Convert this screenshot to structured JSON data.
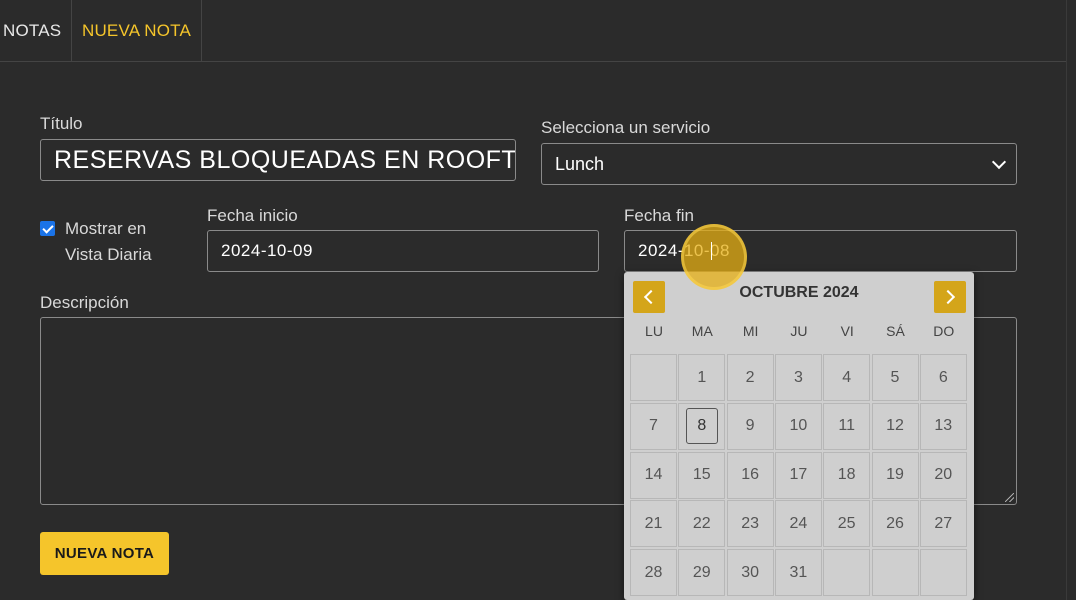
{
  "tabs": [
    {
      "label": "NOTAS"
    },
    {
      "label": "NUEVA NOTA"
    }
  ],
  "form": {
    "title_label": "Título",
    "title_value": "RESERVAS BLOQUEADAS EN ROOFT",
    "service_label": "Selecciona un servicio",
    "service_value": "Lunch",
    "show_daily_label": "Mostrar en Vista Diaria",
    "show_daily_checked": true,
    "start_label": "Fecha inicio",
    "start_value": "2024-10-09",
    "end_label": "Fecha fin",
    "end_value": "2024-10-08",
    "description_label": "Descripción",
    "description_value": "",
    "submit_label": "NUEVA NOTA"
  },
  "calendar": {
    "title": "OCTUBRE 2024",
    "weekdays": [
      "LU",
      "MA",
      "MI",
      "JU",
      "VI",
      "SÁ",
      "DO"
    ],
    "selected_day": "8",
    "weeks": [
      [
        "",
        "1",
        "2",
        "3",
        "4",
        "5",
        "6"
      ],
      [
        "7",
        "8",
        "9",
        "10",
        "11",
        "12",
        "13"
      ],
      [
        "14",
        "15",
        "16",
        "17",
        "18",
        "19",
        "20"
      ],
      [
        "21",
        "22",
        "23",
        "24",
        "25",
        "26",
        "27"
      ],
      [
        "28",
        "29",
        "30",
        "31",
        "",
        "",
        ""
      ]
    ]
  },
  "colors": {
    "accent": "#f5c52b",
    "background": "#2b2b2b",
    "calendar_bg": "#cfcfcf",
    "checkbox": "#1a73e8"
  }
}
